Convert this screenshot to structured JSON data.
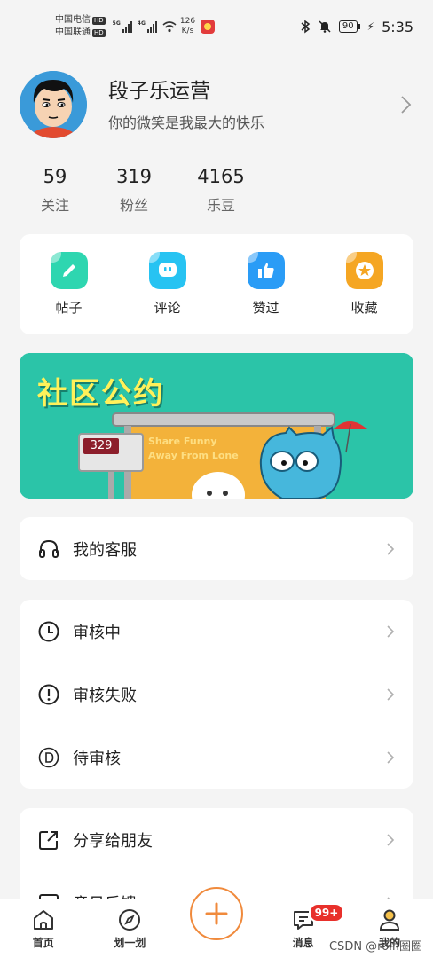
{
  "status_bar": {
    "carrier_1": "中国电信",
    "carrier_2": "中国联通",
    "hd_label": "HD",
    "net_1": "5G",
    "net_2": "4G",
    "speed_value": "126",
    "speed_unit": "K/s",
    "battery": "90",
    "time": "5:35"
  },
  "profile": {
    "nickname": "段子乐运营",
    "bio": "你的微笑是我最大的快乐"
  },
  "stats": [
    {
      "value": "59",
      "label": "关注"
    },
    {
      "value": "319",
      "label": "粉丝"
    },
    {
      "value": "4165",
      "label": "乐豆"
    }
  ],
  "shortcuts": [
    {
      "label": "帖子",
      "icon": "pencil-icon",
      "color": "#2ed6b0"
    },
    {
      "label": "评论",
      "icon": "chat-face-icon",
      "color": "#27c3f2"
    },
    {
      "label": "赞过",
      "icon": "thumbs-up-icon",
      "color": "#2a9cf6"
    },
    {
      "label": "收藏",
      "icon": "star-icon",
      "color": "#f5a623"
    }
  ],
  "banner": {
    "title": "社区公约",
    "sign_number": "329",
    "text_line1": "Share Funny",
    "text_line2": "Away From Lone"
  },
  "menu_group_1": [
    {
      "label": "我的客服",
      "icon": "headphones-icon"
    }
  ],
  "menu_group_2": [
    {
      "label": "审核中",
      "icon": "clock-icon"
    },
    {
      "label": "审核失败",
      "icon": "exclamation-circle-icon"
    },
    {
      "label": "待审核",
      "icon": "d-circle-icon"
    }
  ],
  "menu_group_3": [
    {
      "label": "分享给朋友",
      "icon": "share-icon"
    },
    {
      "label": "意见反馈",
      "icon": "feedback-icon"
    }
  ],
  "bottom_nav": {
    "home": "首页",
    "explore": "划一划",
    "messages": "消息",
    "messages_badge": "99+",
    "profile": "我的"
  },
  "watermark": "CSDN @rolfi圈圈",
  "colors": {
    "accent_orange": "#f08a3c",
    "banner_bg": "#2bc4a8",
    "badge_red": "#e8302b"
  }
}
